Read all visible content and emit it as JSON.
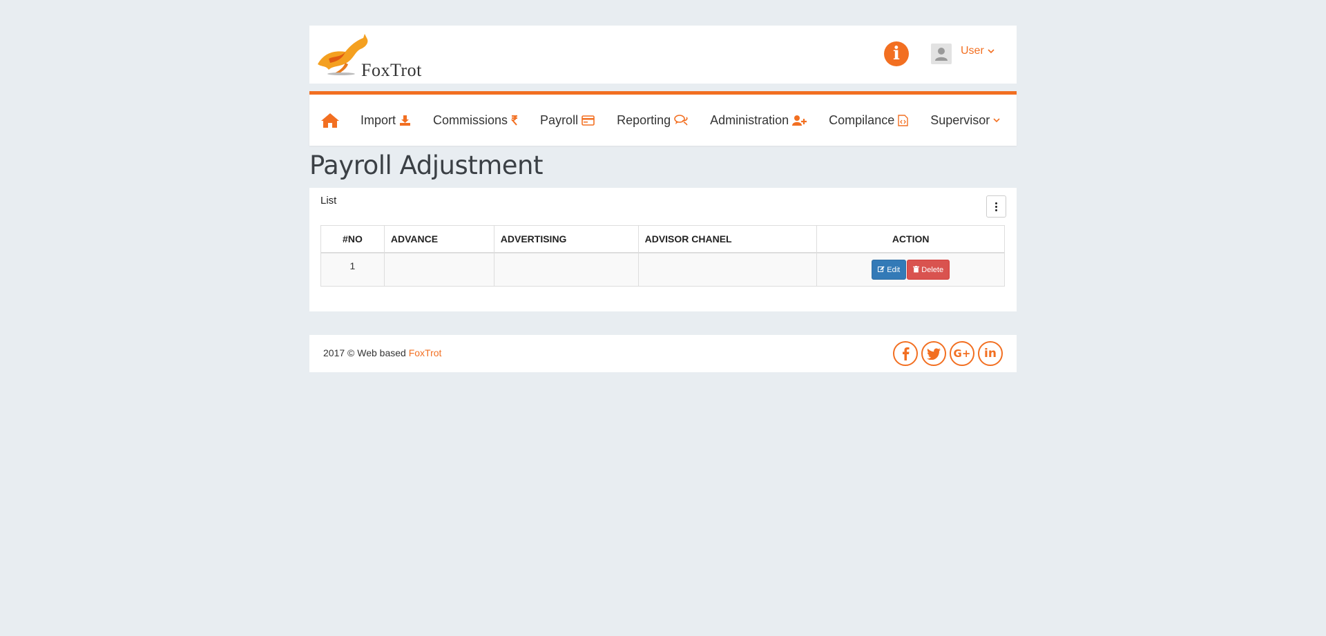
{
  "header": {
    "logo_text": "FoxTrot",
    "user_label": "User"
  },
  "nav": {
    "items": [
      {
        "label": "Import",
        "icon": "download-icon"
      },
      {
        "label": "Commissions",
        "icon": "rupee-icon"
      },
      {
        "label": "Payroll",
        "icon": "credit-card-icon"
      },
      {
        "label": "Reporting",
        "icon": "comments-icon"
      },
      {
        "label": "Administration",
        "icon": "user-plus-icon"
      },
      {
        "label": "Compilance",
        "icon": "file-code-icon"
      },
      {
        "label": "Supervisor",
        "icon": "chevron-down-icon"
      }
    ]
  },
  "page": {
    "title": "Payroll Adjustment"
  },
  "panel": {
    "label": "List",
    "table": {
      "headers": [
        "#NO",
        "ADVANCE",
        "ADVERTISING",
        "ADVISOR CHANEL",
        "ACTION"
      ],
      "rows": [
        {
          "no": "1",
          "advance": "",
          "advertising": "",
          "advisor_chanel": ""
        }
      ],
      "edit_label": "Edit",
      "delete_label": "Delete"
    }
  },
  "footer": {
    "copyright_prefix": "2017 © Web based ",
    "brand": "FoxTrot",
    "social": [
      "facebook-icon",
      "twitter-icon",
      "google-plus-icon",
      "linkedin-icon"
    ]
  },
  "colors": {
    "accent": "#f26f21",
    "edit": "#337ab7",
    "delete": "#d9534f",
    "background": "#e8edf1"
  }
}
